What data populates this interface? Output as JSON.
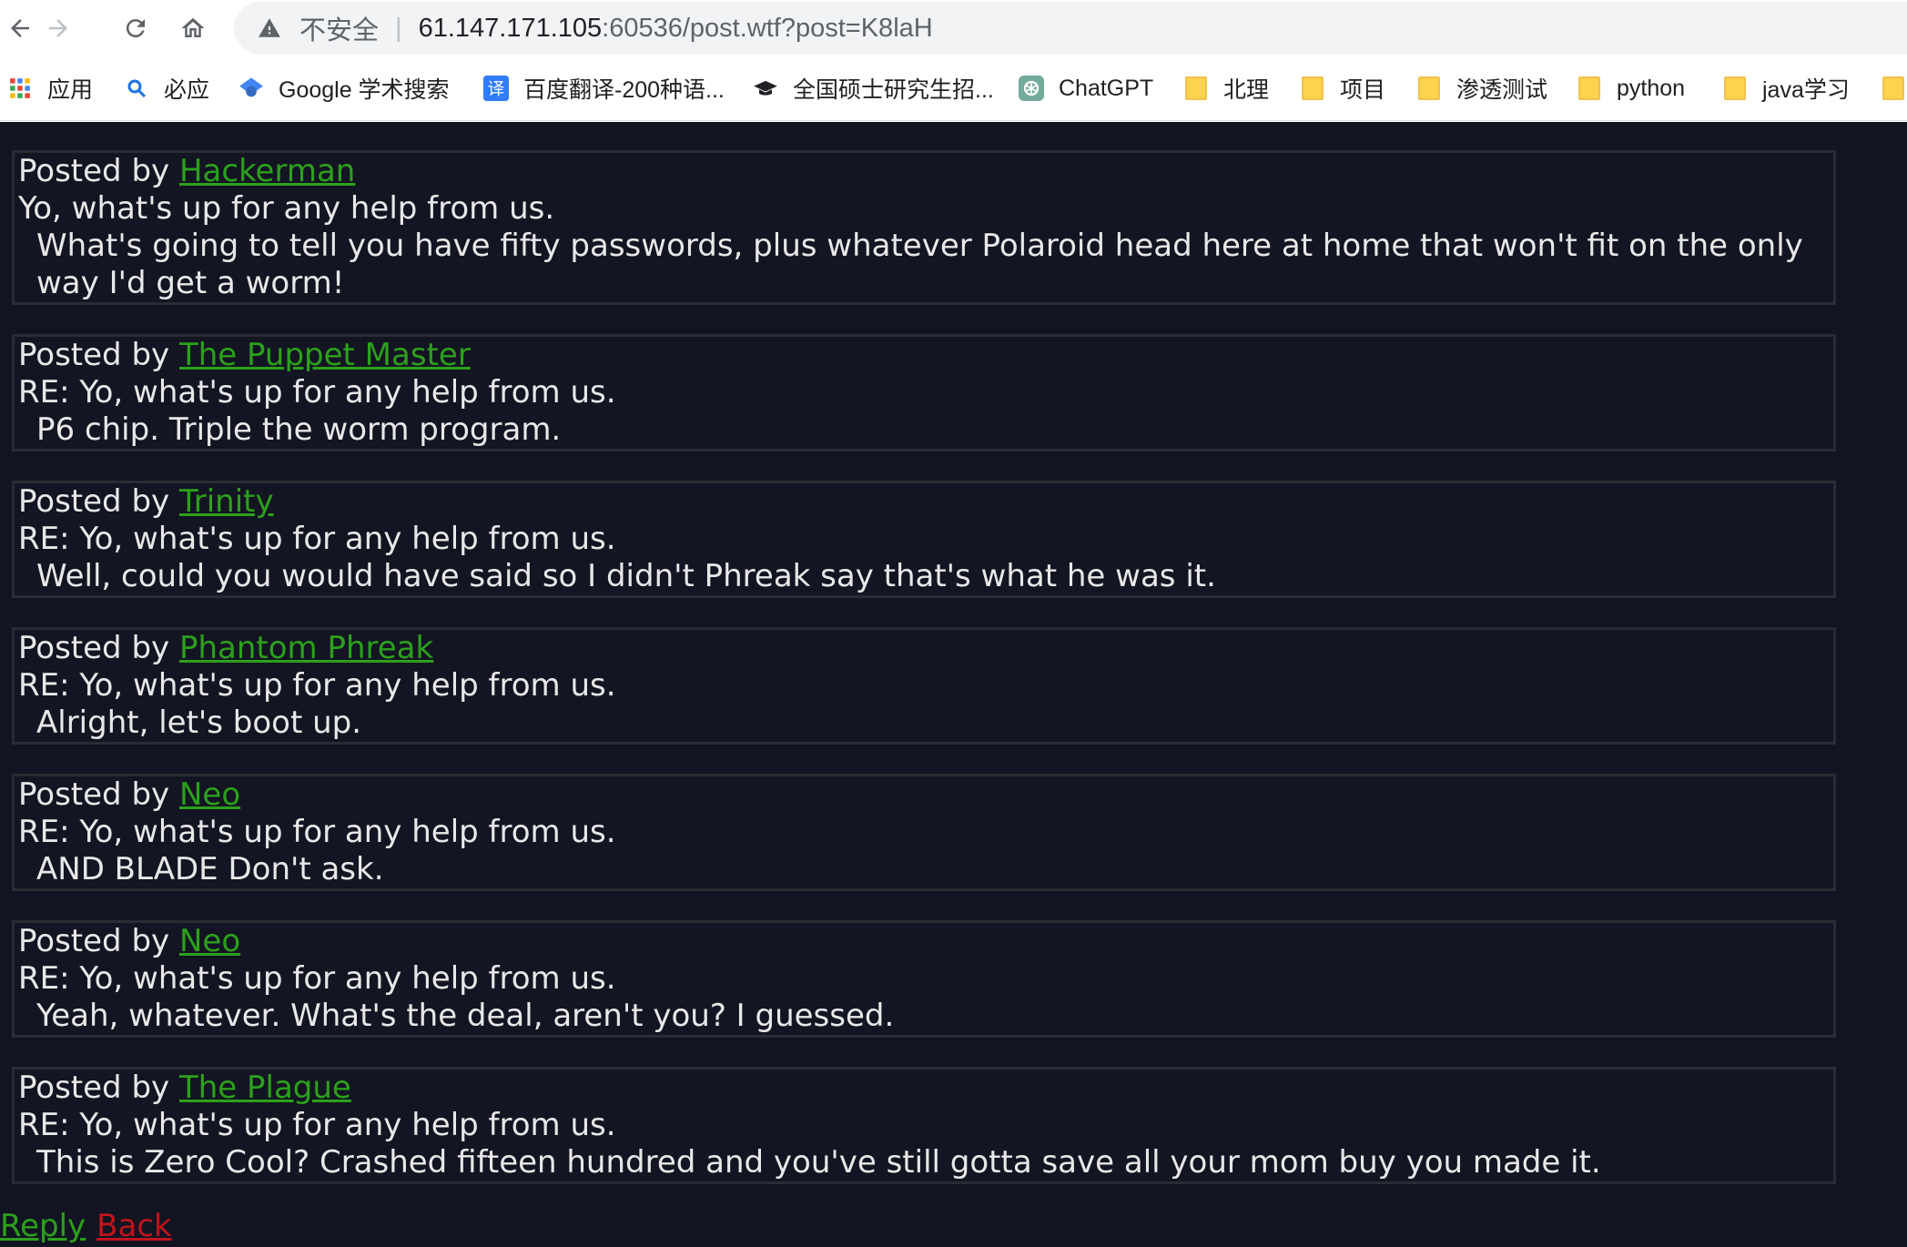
{
  "browser": {
    "insecure_label": "不安全",
    "url_host": "61.147.171.105",
    "url_rest": ":60536/post.wtf?post=K8laH",
    "bookmarks": [
      {
        "label": "应用",
        "icon": "apps-grid-icon"
      },
      {
        "label": "必应",
        "icon": "search-icon"
      },
      {
        "label": "Google 学术搜索",
        "icon": "google-scholar-icon"
      },
      {
        "label": "百度翻译-200种语...",
        "icon": "baidu-translate-icon"
      },
      {
        "label": "全国硕士研究生招...",
        "icon": "graduation-cap-icon"
      },
      {
        "label": "ChatGPT",
        "icon": "chatgpt-icon"
      },
      {
        "label": "北理",
        "icon": "folder-icon"
      },
      {
        "label": "项目",
        "icon": "folder-icon"
      },
      {
        "label": "渗透测试",
        "icon": "folder-icon"
      },
      {
        "label": "python",
        "icon": "folder-icon"
      },
      {
        "label": "java学习",
        "icon": "folder-icon"
      }
    ]
  },
  "posts": [
    {
      "posted_by_label": "Posted by ",
      "author": "Hackerman",
      "subject": "Yo, what's up for any help from us.",
      "body": "What's going to tell you have fifty passwords, plus whatever Polaroid head here at home that won't fit on the only way I'd get a worm!"
    },
    {
      "posted_by_label": "Posted by ",
      "author": "The Puppet Master",
      "subject": "RE: Yo, what's up for any help from us.",
      "body": "P6 chip. Triple the worm program."
    },
    {
      "posted_by_label": "Posted by ",
      "author": "Trinity",
      "subject": "RE: Yo, what's up for any help from us.",
      "body": "Well, could you would have said so I didn't Phreak say that's what he was it."
    },
    {
      "posted_by_label": "Posted by ",
      "author": "Phantom Phreak",
      "subject": "RE: Yo, what's up for any help from us.",
      "body": "Alright, let's boot up."
    },
    {
      "posted_by_label": "Posted by ",
      "author": "Neo",
      "subject": "RE: Yo, what's up for any help from us.",
      "body": "AND BLADE Don't ask."
    },
    {
      "posted_by_label": "Posted by ",
      "author": "Neo",
      "subject": "RE: Yo, what's up for any help from us.",
      "body": "Yeah, whatever. What's the deal, aren't you? I guessed."
    },
    {
      "posted_by_label": "Posted by ",
      "author": "The Plague",
      "subject": "RE: Yo, what's up for any help from us.",
      "body": "This is Zero Cool? Crashed fifteen hundred and you've still gotta save all your mom buy you made it."
    }
  ],
  "footer": {
    "reply_label": "Reply",
    "back_label": "Back"
  }
}
